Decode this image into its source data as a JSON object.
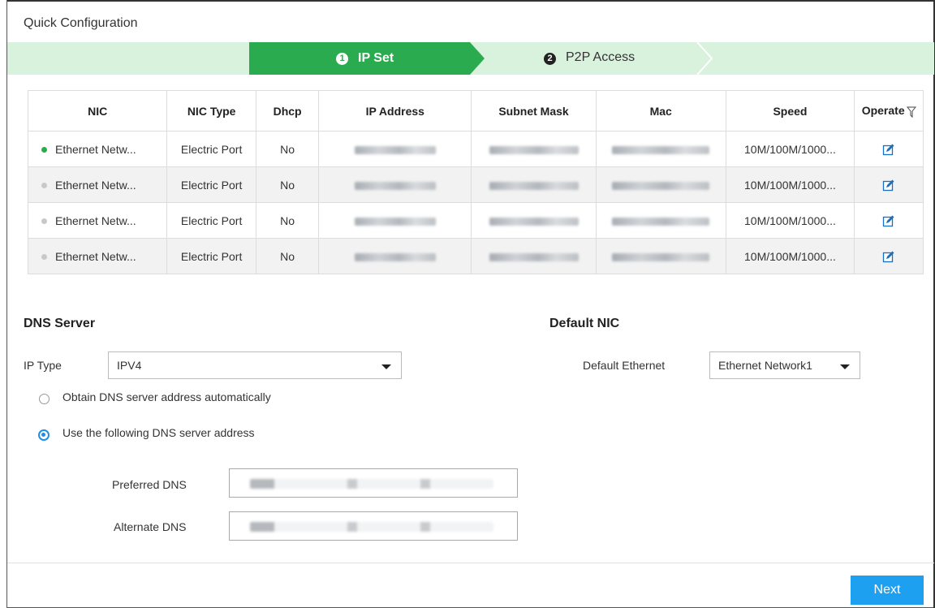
{
  "window": {
    "title": "Quick Configuration"
  },
  "stepper": {
    "steps": [
      {
        "num": "1",
        "label": "IP Set",
        "active": true
      },
      {
        "num": "2",
        "label": "P2P Access",
        "active": false
      }
    ],
    "colors": {
      "active": "#2bab4f",
      "inactive": "#d9f2dd"
    }
  },
  "table": {
    "headers": [
      "NIC",
      "NIC Type",
      "Dhcp",
      "IP Address",
      "Subnet Mask",
      "Mac",
      "Speed",
      "Operate"
    ],
    "rows": [
      {
        "nic": "Ethernet Netw...",
        "status": "online",
        "type": "Electric Port",
        "dhcp": "No",
        "speed": "10M/100M/1000..."
      },
      {
        "nic": "Ethernet Netw...",
        "status": "offline",
        "type": "Electric Port",
        "dhcp": "No",
        "speed": "10M/100M/1000..."
      },
      {
        "nic": "Ethernet Netw...",
        "status": "offline",
        "type": "Electric Port",
        "dhcp": "No",
        "speed": "10M/100M/1000..."
      },
      {
        "nic": "Ethernet Netw...",
        "status": "offline",
        "type": "Electric Port",
        "dhcp": "No",
        "speed": "10M/100M/1000..."
      }
    ],
    "status_colors": {
      "online": "#2bab4f",
      "offline": "#c8c8c8"
    }
  },
  "dns": {
    "title": "DNS Server",
    "ip_type_label": "IP Type",
    "ip_type_value": "IPV4",
    "radio_auto_label": "Obtain DNS server address automatically",
    "radio_manual_label": "Use the following DNS server address",
    "selected": "manual",
    "preferred_label": "Preferred DNS",
    "alternate_label": "Alternate DNS"
  },
  "default_nic": {
    "title": "Default NIC",
    "label": "Default Ethernet",
    "value": "Ethernet Network1"
  },
  "footer": {
    "next_label": "Next",
    "accent": "#1ea0f0"
  }
}
